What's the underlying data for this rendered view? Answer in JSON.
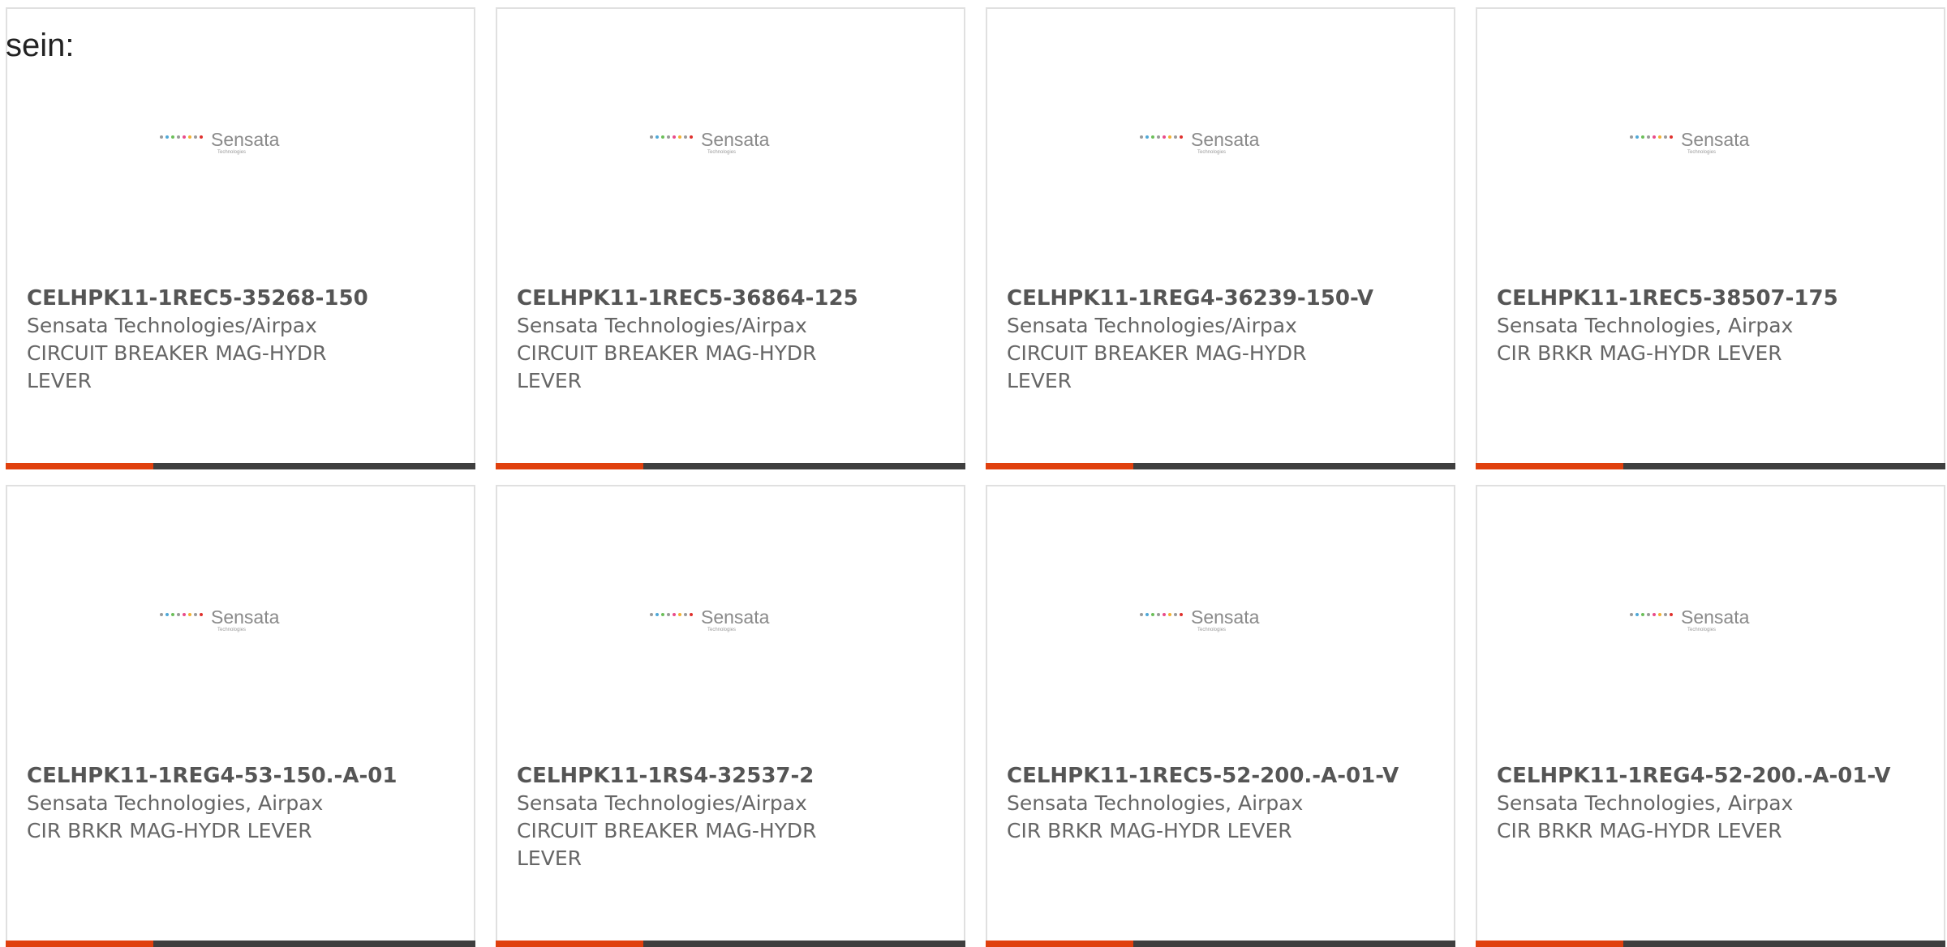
{
  "intro_text": "sein:",
  "accent_color": "#e0400e",
  "bar_color": "#3f3f3f",
  "logo": {
    "name": "Sensata",
    "sub": "Technologies",
    "dot_colors": [
      "#9a9a9a",
      "#4fa8d8",
      "#6bbf59",
      "#9a9a9a",
      "#e94b8a",
      "#f2b134",
      "#9a9a9a",
      "#e0302d"
    ]
  },
  "products": [
    {
      "part": "CELHPK11-1REC5-35268-150",
      "maker": "Sensata Technologies/Airpax",
      "desc": "CIRCUIT BREAKER MAG-HYDR LEVER"
    },
    {
      "part": "CELHPK11-1REC5-36864-125",
      "maker": "Sensata Technologies/Airpax",
      "desc": "CIRCUIT BREAKER MAG-HYDR LEVER"
    },
    {
      "part": "CELHPK11-1REG4-36239-150-V",
      "maker": "Sensata Technologies/Airpax",
      "desc": "CIRCUIT BREAKER MAG-HYDR LEVER"
    },
    {
      "part": "CELHPK11-1REC5-38507-175",
      "maker": "Sensata Technologies, Airpax",
      "desc": "CIR BRKR MAG-HYDR LEVER"
    },
    {
      "part": "CELHPK11-1REG4-53-150.-A-01",
      "maker": "Sensata Technologies, Airpax",
      "desc": "CIR BRKR MAG-HYDR LEVER"
    },
    {
      "part": "CELHPK11-1RS4-32537-2",
      "maker": "Sensata Technologies/Airpax",
      "desc": "CIRCUIT BREAKER MAG-HYDR LEVER"
    },
    {
      "part": "CELHPK11-1REC5-52-200.-A-01-V",
      "maker": "Sensata Technologies, Airpax",
      "desc": "CIR BRKR MAG-HYDR LEVER"
    },
    {
      "part": "CELHPK11-1REG4-52-200.-A-01-V",
      "maker": "Sensata Technologies, Airpax",
      "desc": "CIR BRKR MAG-HYDR LEVER"
    }
  ]
}
